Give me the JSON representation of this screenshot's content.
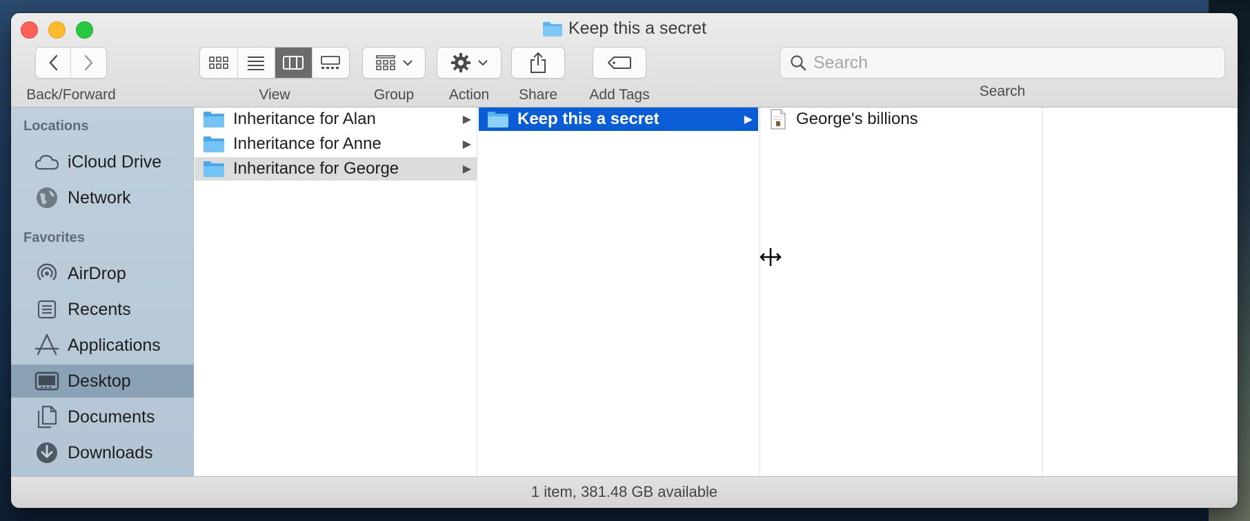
{
  "window": {
    "title": "Keep this a secret"
  },
  "toolbar": {
    "back_forward_label": "Back/Forward",
    "view_label": "View",
    "group_label": "Group",
    "action_label": "Action",
    "share_label": "Share",
    "tags_label": "Add Tags",
    "search_label": "Search",
    "search_placeholder": "Search",
    "active_view": "columns"
  },
  "sidebar": {
    "locations_header": "Locations",
    "favorites_header": "Favorites",
    "locations": [
      {
        "label": "iCloud Drive",
        "icon": "cloud-icon"
      },
      {
        "label": "Network",
        "icon": "globe-icon"
      }
    ],
    "favorites": [
      {
        "label": "AirDrop",
        "icon": "airdrop-icon"
      },
      {
        "label": "Recents",
        "icon": "clock-icon"
      },
      {
        "label": "Applications",
        "icon": "applications-icon"
      },
      {
        "label": "Desktop",
        "icon": "desktop-icon",
        "selected": true
      },
      {
        "label": "Documents",
        "icon": "documents-icon"
      },
      {
        "label": "Downloads",
        "icon": "download-icon"
      }
    ]
  },
  "columns": {
    "col1": [
      "Inheritance for Alan",
      "Inheritance for Anne",
      "Inheritance for George"
    ],
    "col2": [
      "Keep this a secret"
    ],
    "col3": [
      "George's billions"
    ]
  },
  "status": {
    "text": "1 item, 381.48 GB available"
  },
  "colors": {
    "selection_blue": "#0a5dd4",
    "sidebar_selected": "#8aa1b6",
    "folder_blue": "#5ab4f0"
  }
}
